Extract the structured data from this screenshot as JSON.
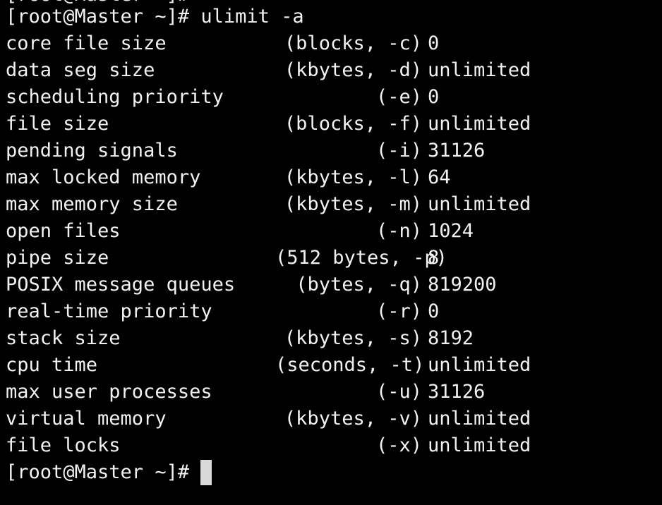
{
  "terminal": {
    "colors": {
      "background": "#000000",
      "foreground": "#f2f2f2",
      "cursor": "#d9d9d9"
    },
    "clipped_top_line": "[root@Master ~]#",
    "command_line": "[root@Master ~]# ulimit -a",
    "rows": [
      {
        "name": "core file size",
        "unit": "(blocks, -c)",
        "value": "0"
      },
      {
        "name": "data seg size",
        "unit": "(kbytes, -d)",
        "value": "unlimited"
      },
      {
        "name": "scheduling priority",
        "unit": "(-e)",
        "value": "0"
      },
      {
        "name": "file size",
        "unit": "(blocks, -f)",
        "value": "unlimited"
      },
      {
        "name": "pending signals",
        "unit": "(-i)",
        "value": "31126"
      },
      {
        "name": "max locked memory",
        "unit": "(kbytes, -l)",
        "value": "64"
      },
      {
        "name": "max memory size",
        "unit": "(kbytes, -m)",
        "value": "unlimited"
      },
      {
        "name": "open files",
        "unit": "(-n)",
        "value": "1024"
      },
      {
        "name": "pipe size",
        "unit": "(512 bytes, -p)",
        "value": "8"
      },
      {
        "name": "POSIX message queues",
        "unit": "(bytes, -q)",
        "value": "819200"
      },
      {
        "name": "real-time priority",
        "unit": "(-r)",
        "value": "0"
      },
      {
        "name": "stack size",
        "unit": "(kbytes, -s)",
        "value": "8192"
      },
      {
        "name": "cpu time",
        "unit": "(seconds, -t)",
        "value": "unlimited"
      },
      {
        "name": "max user processes",
        "unit": "(-u)",
        "value": "31126"
      },
      {
        "name": "virtual memory",
        "unit": "(kbytes, -v)",
        "value": "unlimited"
      },
      {
        "name": "file locks",
        "unit": "(-x)",
        "value": "unlimited"
      }
    ],
    "prompt": "[root@Master ~]#"
  }
}
